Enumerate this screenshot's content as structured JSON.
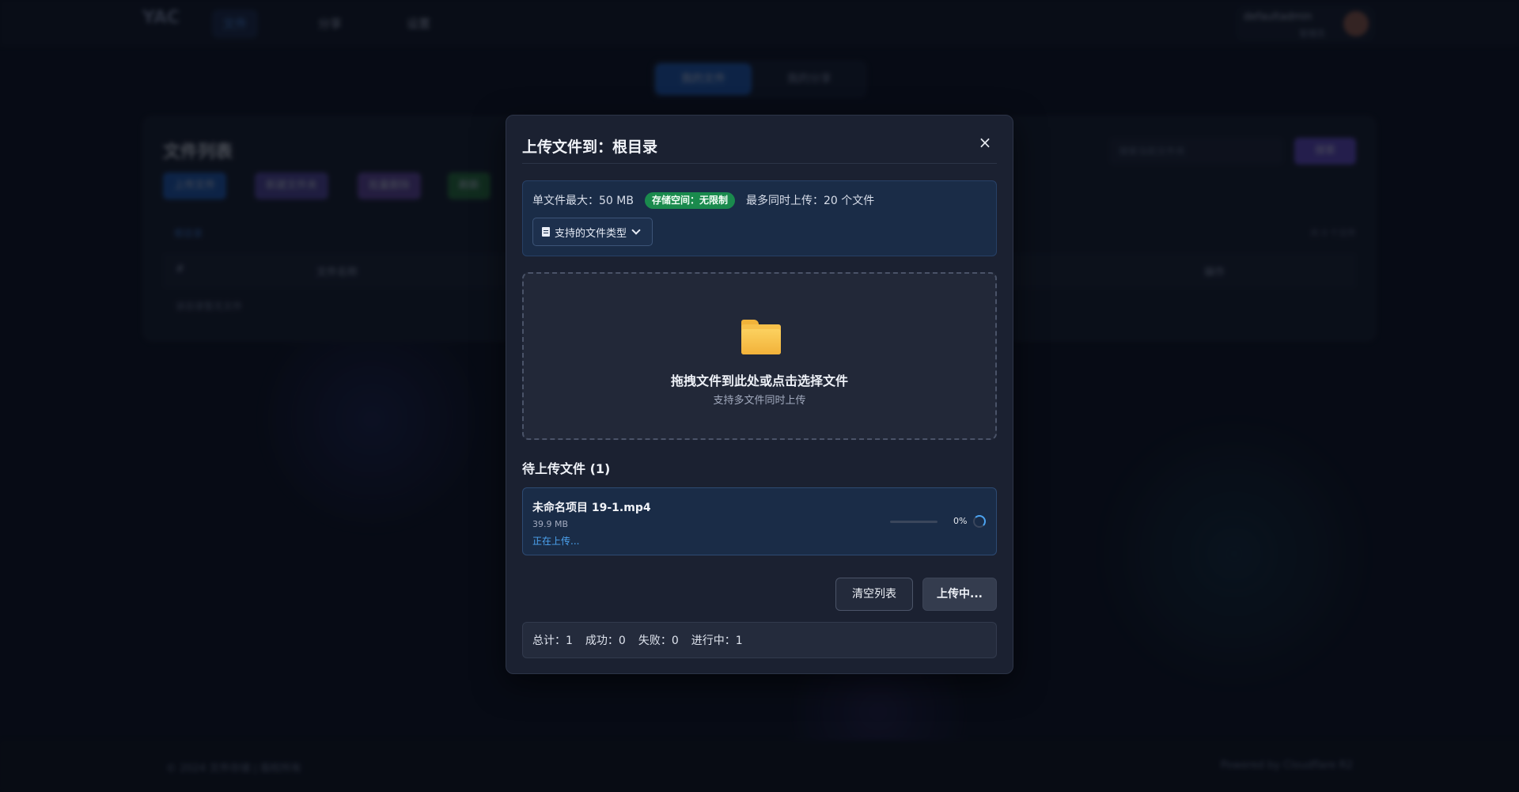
{
  "app": {
    "logo": "YAC",
    "nav": [
      {
        "label": "文件"
      },
      {
        "label": "分享"
      },
      {
        "label": "设置"
      }
    ],
    "user": {
      "name": "defaultadmin",
      "role": "管理员"
    },
    "segments": {
      "upload": "我的文件",
      "shared": "我的分享"
    },
    "panel": {
      "title": "文件列表",
      "buttons": [
        "上传文件",
        "新建文件夹",
        "批量删除",
        "刷新"
      ],
      "search_placeholder": "搜索当前文件夹",
      "search_button": "搜索",
      "breadcrumb": "根目录",
      "meta": "共 0 个文件",
      "columns": [
        "#",
        "文件名称",
        "操作"
      ],
      "empty": "该目录暂无文件"
    },
    "footer": {
      "left": "© 2024 文件存储 | 版权所有",
      "right": "Powered by Cloudflare R2"
    }
  },
  "modal": {
    "title": "上传文件到：根目录",
    "close": "×",
    "info": {
      "max_size": "单文件最大：50 MB",
      "storage_badge": "存储空间：无限制",
      "max_concurrent": "最多同时上传：20 个文件",
      "types_button": "支持的文件类型"
    },
    "dropzone": {
      "main": "拖拽文件到此处或点击选择文件",
      "sub": "支持多文件同时上传"
    },
    "pending_title": "待上传文件 (1)",
    "files": [
      {
        "name": "未命名项目 19-1.mp4",
        "size": "39.9 MB",
        "status": "正在上传...",
        "progress_percent": 0,
        "progress_label": "0%"
      }
    ],
    "buttons": {
      "clear": "清空列表",
      "upload": "上传中..."
    },
    "stats": {
      "total": "总计：1",
      "success": "成功：0",
      "failed": "失败：0",
      "in_progress": "进行中：1"
    }
  },
  "colors": {
    "accent": "#4ca3f0",
    "badge_green": "#1a8a4d",
    "folder_yellow": "#f7c04a",
    "modal_bg": "#1b2131"
  }
}
